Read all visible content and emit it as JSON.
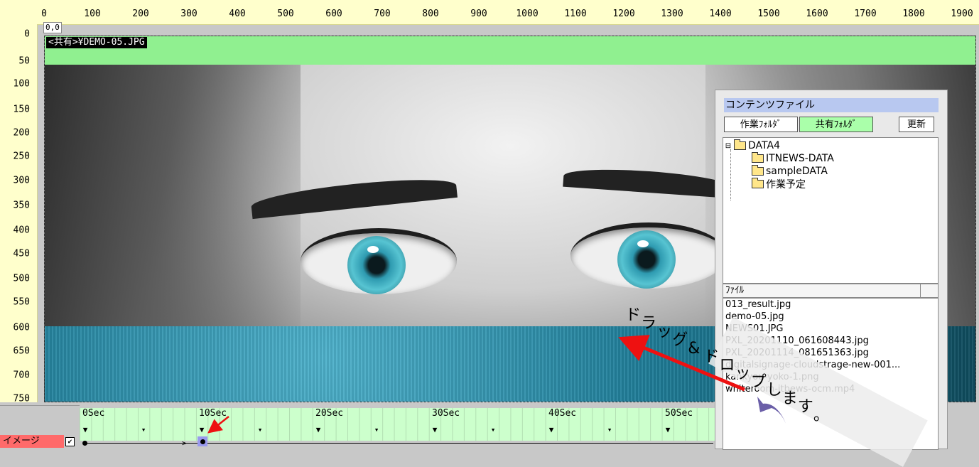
{
  "ruler": {
    "top_labels": [
      "0",
      "100",
      "200",
      "300",
      "400",
      "500",
      "600",
      "700",
      "800",
      "900",
      "1000",
      "1100",
      "1200",
      "1300",
      "1400",
      "1500",
      "1600",
      "1700",
      "1800",
      "1900"
    ],
    "left_labels": [
      "0",
      "50",
      "100",
      "150",
      "200",
      "250",
      "300",
      "350",
      "400",
      "450",
      "500",
      "550",
      "600",
      "650",
      "700",
      "750"
    ],
    "origin_label": "0,0"
  },
  "canvas": {
    "path_label": "<共有>¥DEMO-05.JPG",
    "band_color": "#90f090"
  },
  "timeline": {
    "time_labels": [
      "0Sec",
      "10Sec",
      "20Sec",
      "30Sec",
      "40Sec",
      "50Sec"
    ],
    "layer_name": "イメージ",
    "layer_checked": "✔",
    "layer_color": "#ff6a6a"
  },
  "panel": {
    "title": "コンテンツファイル",
    "tabs": {
      "work": "作業ﾌｫﾙﾀﾞ",
      "share": "共有ﾌｫﾙﾀﾞ"
    },
    "refresh": "更新",
    "tree": {
      "root": "DATA4",
      "children": [
        "ITNEWS-DATA",
        "sampleDATA",
        "作業予定"
      ]
    },
    "files_header": "ﾌｧｲﾙ",
    "files": [
      "013_result.jpg",
      "demo-05.jpg",
      "NEWS01.JPG",
      "PXL_20201110_061608443.jpg",
      "PXL_20201114_081651363.jpg",
      "digitalsignage-cloudstrage-new-001...",
      "kankyou-yoko-1.png",
      "whiteroom-itbews-ocm.mp4"
    ]
  },
  "annotation": {
    "text": "ドラッグ&ドロップします。"
  },
  "colors": {
    "ruler": "#ffffcc",
    "timeline_grid": "#ccffcc",
    "arrow": "#ee1111",
    "curve_arrow": "#6b5fa8",
    "panel_title": "#b8c8f0",
    "share_tab": "#aaffaa"
  }
}
